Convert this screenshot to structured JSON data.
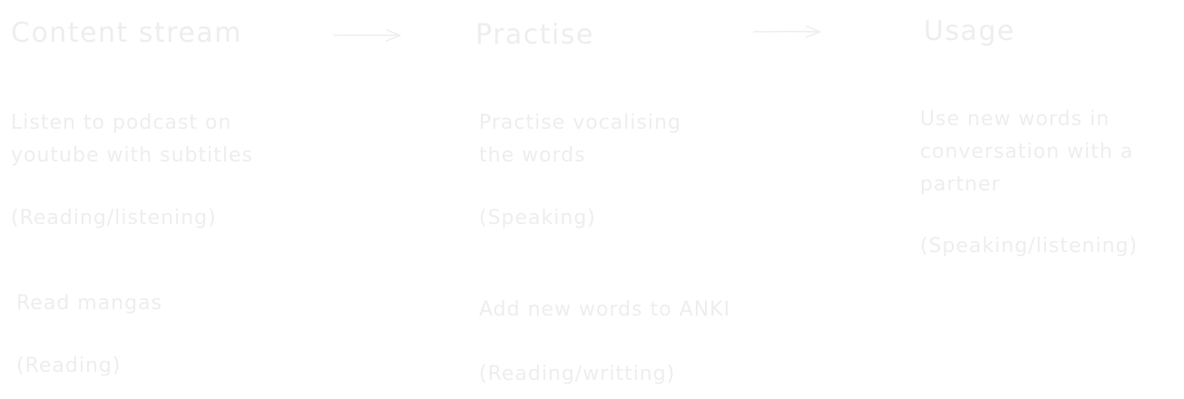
{
  "stages": [
    {
      "title": "Content stream",
      "activities": [
        {
          "description": [
            "Listen to podcast on",
            "youtube with subtitles"
          ],
          "skill": "(Reading/listening)"
        },
        {
          "description": [
            "Read mangas"
          ],
          "skill": "(Reading)"
        }
      ]
    },
    {
      "title": "Practise",
      "activities": [
        {
          "description": [
            "Practise vocalising",
            "the words"
          ],
          "skill": "(Speaking)"
        },
        {
          "description": [
            "Add new words to ANKI"
          ],
          "skill": "(Reading/writting)"
        }
      ]
    },
    {
      "title": "Usage",
      "activities": [
        {
          "description": [
            "Use new words in",
            "conversation with a",
            "partner"
          ],
          "skill": "(Speaking/listening)"
        }
      ]
    }
  ]
}
